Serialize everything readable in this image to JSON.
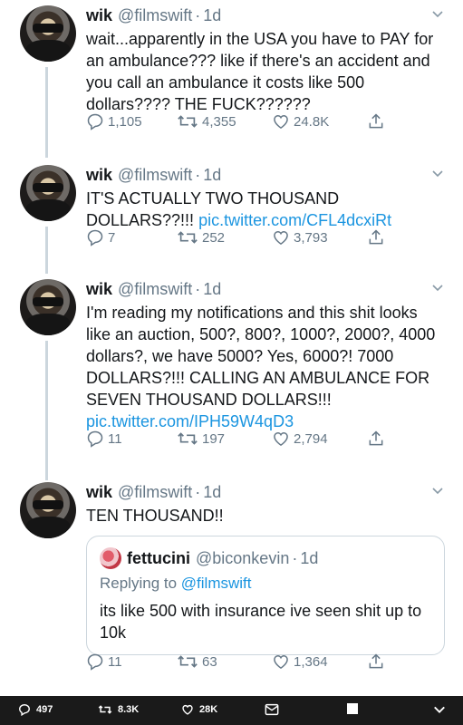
{
  "tweets": [
    {
      "name": "wik",
      "handle": "@filmswift",
      "dot": "·",
      "time": "1d",
      "text": "wait...apparently in the USA you have to PAY for an ambulance??? like if there's an accident and you call an ambulance it costs like 500 dollars???? THE FUCK??????",
      "link": "",
      "replies": "1,105",
      "retweets": "4,355",
      "likes": "24.8K"
    },
    {
      "name": "wik",
      "handle": "@filmswift",
      "dot": "·",
      "time": "1d",
      "text": "IT'S ACTUALLY TWO THOUSAND DOLLARS??!!! ",
      "link": "pic.twitter.com/CFL4dcxiRt",
      "replies": "7",
      "retweets": "252",
      "likes": "3,793"
    },
    {
      "name": "wik",
      "handle": "@filmswift",
      "dot": "·",
      "time": "1d",
      "text": "I'm reading my notifications and this shit looks like an auction, 500?, 800?, 1000?, 2000?, 4000 dollars?, we have 5000? Yes, 6000?! 7000 DOLLARS?!!! CALLING AN AMBULANCE FOR SEVEN THOUSAND DOLLARS!!! ",
      "link": "pic.twitter.com/IPH59W4qD3",
      "replies": "11",
      "retweets": "197",
      "likes": "2,794"
    },
    {
      "name": "wik",
      "handle": "@filmswift",
      "dot": "·",
      "time": "1d",
      "text": "TEN THOUSAND!!",
      "link": "",
      "replies": "11",
      "retweets": "63",
      "likes": "1,364",
      "quote": {
        "name": "fettucini",
        "handle": "@biconkevin",
        "dot": "·",
        "time": "1d",
        "replying_prefix": "Replying to ",
        "replying_to": "@filmswift",
        "text": "its like 500 with insurance ive seen shit up to 10k"
      }
    }
  ],
  "bottom_bar": {
    "replies": "497",
    "retweets": "8.3K",
    "likes": "28K"
  },
  "colors": {
    "link": "#1b95e0",
    "muted": "#657786",
    "thread_line": "#ccd6dd",
    "bar_bg": "#1a1a1a"
  },
  "icons": [
    "reply-icon",
    "retweet-icon",
    "like-icon",
    "share-icon",
    "chevron-down-icon",
    "dm-icon",
    "stop-icon"
  ]
}
